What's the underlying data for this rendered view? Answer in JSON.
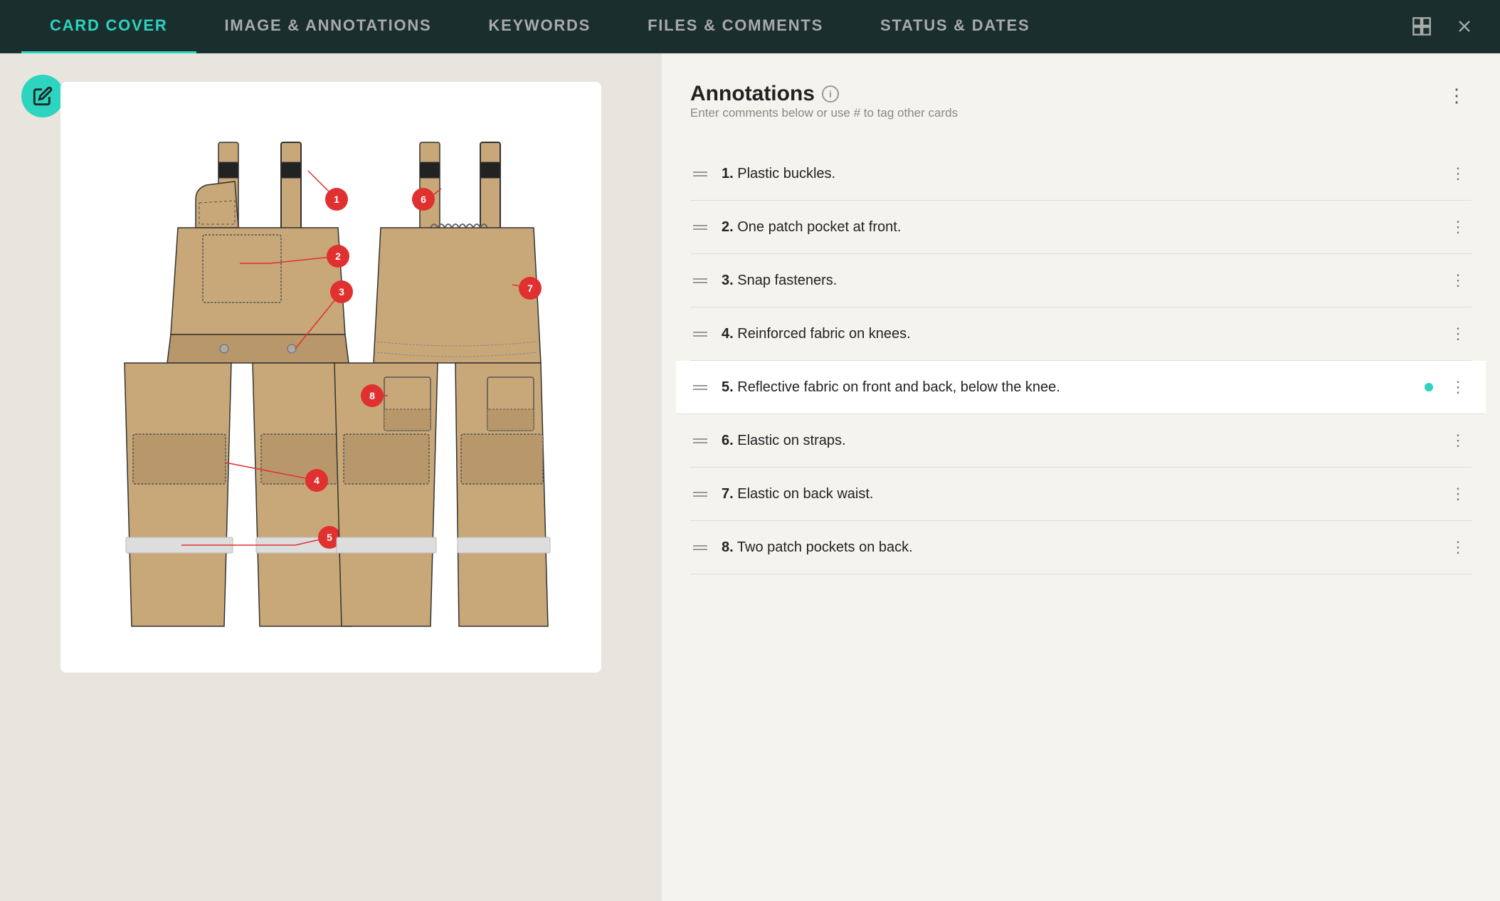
{
  "nav": {
    "tabs": [
      {
        "id": "card-cover",
        "label": "CARD COVER",
        "active": true
      },
      {
        "id": "image-annotations",
        "label": "IMAGE & ANNOTATIONS",
        "active": false
      },
      {
        "id": "keywords",
        "label": "KEYWORDS",
        "active": false
      },
      {
        "id": "files-comments",
        "label": "FILES & COMMENTS",
        "active": false
      },
      {
        "id": "status-dates",
        "label": "STATUS & DATES",
        "active": false
      }
    ]
  },
  "edit_button": {
    "icon": "✏"
  },
  "annotations": {
    "title": "Annotations",
    "subtitle": "Enter comments below or use # to tag other cards",
    "info_tooltip": "i",
    "items": [
      {
        "number": "1",
        "text": "Plastic buckles.",
        "active_dot": false
      },
      {
        "number": "2",
        "text": "One patch pocket at front.",
        "active_dot": false
      },
      {
        "number": "3",
        "text": "Snap fasteners.",
        "active_dot": false
      },
      {
        "number": "4",
        "text": "Reinforced fabric on knees.",
        "active_dot": false
      },
      {
        "number": "5",
        "text": "Reflective fabric on front and back, below the knee.",
        "active_dot": true
      },
      {
        "number": "6",
        "text": "Elastic on straps.",
        "active_dot": false
      },
      {
        "number": "7",
        "text": "Elastic on back waist.",
        "active_dot": false
      },
      {
        "number": "8",
        "text": "Two patch pockets on back.",
        "active_dot": false
      }
    ]
  },
  "overalls": {
    "annotation_points": [
      {
        "id": "1",
        "cx": "335",
        "cy": "160"
      },
      {
        "id": "2",
        "cx": "300",
        "cy": "250"
      },
      {
        "id": "3",
        "cx": "340",
        "cy": "292"
      },
      {
        "id": "4",
        "cx": "415",
        "cy": "560"
      },
      {
        "id": "5",
        "cx": "410",
        "cy": "640"
      },
      {
        "id": "6",
        "cx": "540",
        "cy": "160"
      },
      {
        "id": "7",
        "cx": "678",
        "cy": "285"
      },
      {
        "id": "8",
        "cx": "476",
        "cy": "436"
      }
    ]
  }
}
